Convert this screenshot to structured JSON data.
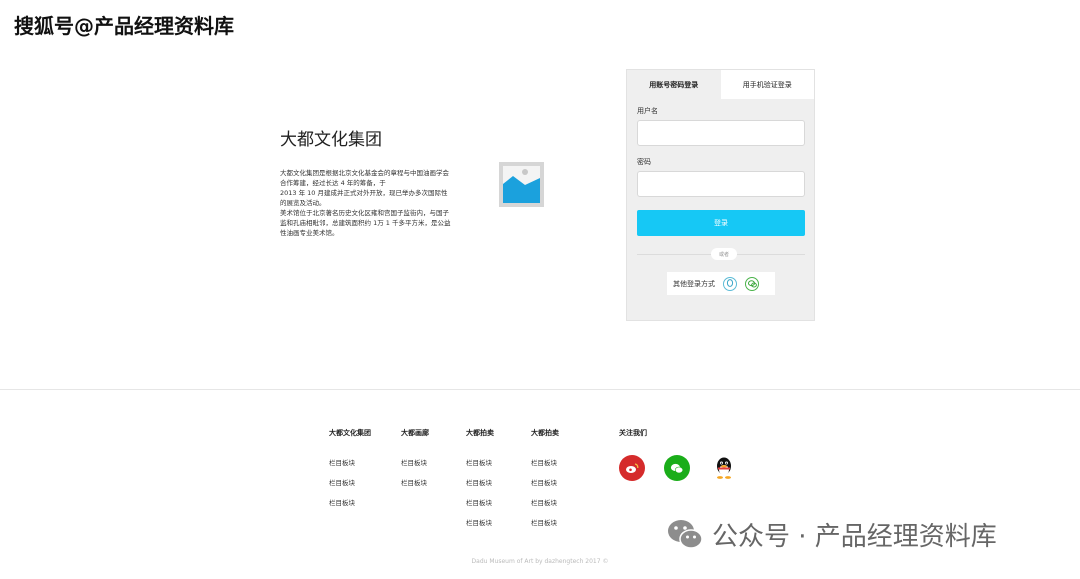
{
  "watermark_top": "搜狐号@产品经理资料库",
  "brand": {
    "title": "大都文化集团",
    "desc_lines": [
      "大都文化集团是根据北京文化基金会的章程与中国油画学会",
      "合作筹建，经过长达 4 年的筹备，于",
      "2013 年 10 月建成并正式对外开放，现已举办多次国际性",
      "的展览及活动。",
      "美术馆位于北京著名历史文化区雍和宫国子监街内，与国子",
      "监和孔庙相毗邻，总建筑面积约 1万 1 千多平方米，是公益",
      "性油画专业美术馆。"
    ]
  },
  "login": {
    "tabs": [
      "用账号密码登录",
      "用手机验证登录"
    ],
    "username_label": "用户名",
    "password_label": "密码",
    "username_value": "",
    "password_value": "",
    "submit_label": "登录",
    "divider_label": "或者",
    "other_label": "其他登录方式"
  },
  "footer": {
    "columns": [
      {
        "head": "大都文化集团",
        "items": [
          "栏目板块",
          "栏目板块",
          "栏目板块"
        ]
      },
      {
        "head": "大都画廊",
        "items": [
          "栏目板块",
          "栏目板块"
        ]
      },
      {
        "head": "大都拍卖",
        "items": [
          "栏目板块",
          "栏目板块",
          "栏目板块",
          "栏目板块"
        ]
      },
      {
        "head": "大都拍卖",
        "items": [
          "栏目板块",
          "栏目板块",
          "栏目板块",
          "栏目板块"
        ]
      }
    ],
    "follow_label": "关注我们",
    "copyright": "Dadu Museum of Art by dazhengtech 2017 ©"
  },
  "watermark_bottom": "公众号 · 产品经理资料库",
  "colors": {
    "accent": "#16c8f5",
    "weibo": "#d52b2b",
    "wechat": "#1aad19"
  }
}
